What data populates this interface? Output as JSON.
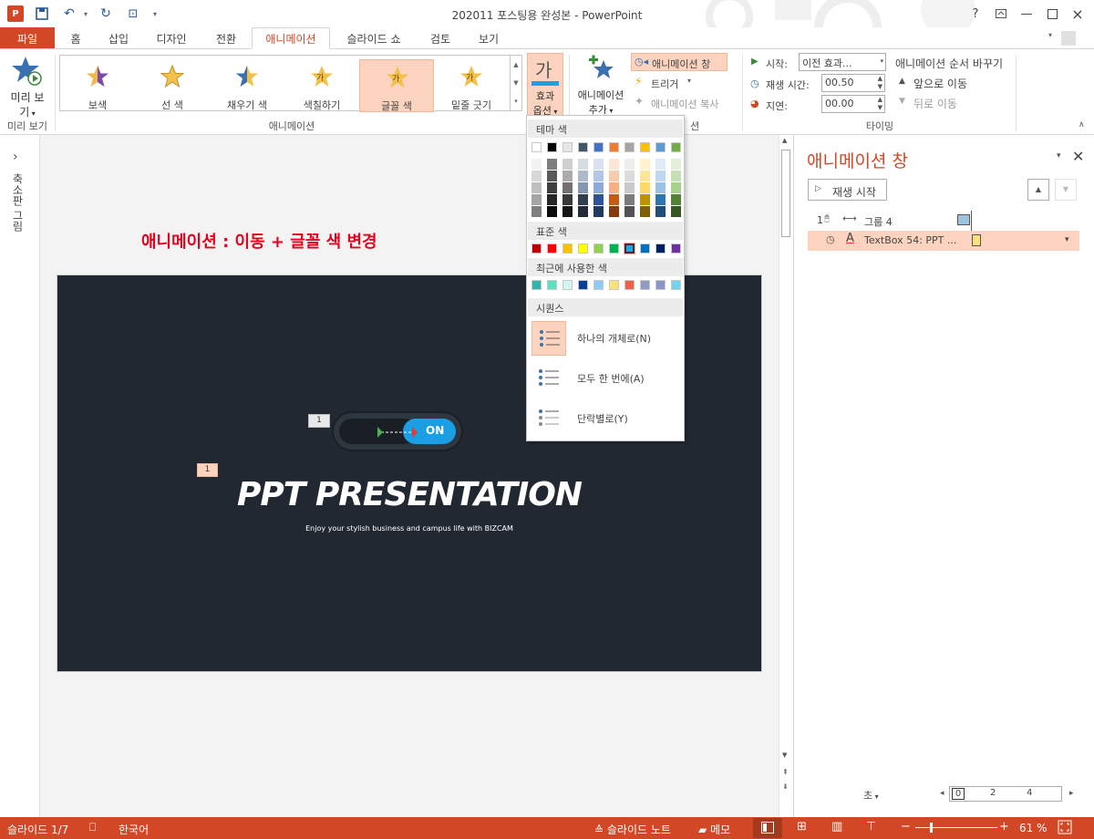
{
  "window": {
    "title": "202011 포스팅용 완성본 - PowerPoint",
    "help": "?",
    "close": "×"
  },
  "ribbon_tabs": {
    "file": "파일",
    "items": [
      "홈",
      "삽입",
      "디자인",
      "전환",
      "애니메이션",
      "슬라이드 쇼",
      "검토",
      "보기"
    ],
    "active": "애니메이션"
  },
  "preview": {
    "label_line1": "미리 보",
    "label_line2": "기",
    "group": "미리 보기"
  },
  "animations_gallery": {
    "items": [
      {
        "label": "보색",
        "icon": "star-two-tone-icon"
      },
      {
        "label": "선 색",
        "icon": "star-gold-icon"
      },
      {
        "label": "채우기 색",
        "icon": "star-blue-gold-icon"
      },
      {
        "label": "색칠하기",
        "icon": "star-text-icon",
        "glyph": "가"
      },
      {
        "label": "글꼴 색",
        "icon": "star-text-icon",
        "glyph": "가"
      },
      {
        "label": "밑줄 긋기",
        "icon": "star-text-icon",
        "glyph": "가"
      }
    ],
    "selected_index": 4,
    "group": "애니메이션"
  },
  "effect_options": {
    "glyph": "가",
    "line1": "효과",
    "line2": "옵션",
    "accent": "#1ba1e2"
  },
  "add_animation": {
    "line1": "애니메이션",
    "line2": "추가"
  },
  "advanced": {
    "pane_btn": "애니메이션 창",
    "trigger": "트리거",
    "painter": "애니메이션 복사",
    "group_suffix": "션"
  },
  "timing": {
    "start_label": "시작:",
    "start_value": "이전 효과...",
    "duration_label": "재생 시간:",
    "duration_value": "00.50",
    "delay_label": "지연:",
    "delay_value": "00.00",
    "reorder_title": "애니메이션 순서 바꾸기",
    "move_earlier": "앞으로 이동",
    "move_later": "뒤로 이동",
    "group": "타이밍"
  },
  "dropdown": {
    "theme_header": "테마 색",
    "standard_header": "표준 색",
    "recent_header": "최근에 사용한 색",
    "sequence_header": "시퀀스",
    "theme_top": [
      "#ffffff",
      "#000000",
      "#e7e6e6",
      "#44546a",
      "#4472c4",
      "#ed7d31",
      "#a5a5a5",
      "#ffc000",
      "#5b9bd5",
      "#70ad47"
    ],
    "theme_shades": [
      [
        "#f2f2f2",
        "#7f7f7f",
        "#d0cece",
        "#d6dce4",
        "#d9e2f3",
        "#fbe5d5",
        "#ededed",
        "#fff2cc",
        "#deebf6",
        "#e2efd9"
      ],
      [
        "#d8d8d8",
        "#595959",
        "#aeabab",
        "#adb9ca",
        "#b4c6e7",
        "#f7cbac",
        "#dbdbdb",
        "#fee599",
        "#bdd7ee",
        "#c5e0b3"
      ],
      [
        "#bfbfbf",
        "#3f3f3f",
        "#757070",
        "#8496b0",
        "#8eaadb",
        "#f4b183",
        "#c9c9c9",
        "#ffd966",
        "#9cc3e5",
        "#a8d08d"
      ],
      [
        "#a5a5a5",
        "#262626",
        "#3a3838",
        "#323f4f",
        "#2f5496",
        "#c55a11",
        "#7b7b7b",
        "#bf9000",
        "#2e75b5",
        "#538135"
      ],
      [
        "#7f7f7f",
        "#0c0c0c",
        "#171616",
        "#222a35",
        "#1f3864",
        "#833c0b",
        "#525252",
        "#7f6000",
        "#1e4e79",
        "#375623"
      ]
    ],
    "standard": [
      "#c00000",
      "#ff0000",
      "#ffc000",
      "#ffff00",
      "#92d050",
      "#00b050",
      "#00b0f0",
      "#0070c0",
      "#002060",
      "#7030a0"
    ],
    "standard_selected_index": 6,
    "recent": [
      "#33b3ab",
      "#5ce1c0",
      "#d5f6ef",
      "#0a3e99",
      "#8fcbf2",
      "#ffe17a",
      "#f05f4a",
      "#8f9cc8",
      "#8a96c8",
      "#72d3ef"
    ],
    "sequence": [
      {
        "label": "하나의 개체로(N)",
        "icon": "as-one-object-icon"
      },
      {
        "label": "모두 한 번에(A)",
        "icon": "all-at-once-icon"
      },
      {
        "label": "단락별로(Y)",
        "icon": "by-paragraph-icon"
      }
    ]
  },
  "leftbar": {
    "expand": "›",
    "label": "축소판 그림"
  },
  "slide": {
    "heading": "애니메이션 : 이동 + 글꼴 색 변경",
    "heading_color": "#e8001c",
    "tag_1": "1",
    "tag_2": "1",
    "toggle_text": "ON",
    "title": "PPT PRESENTATION",
    "subtitle": "Enjoy your stylish business and campus life with BIZCAM"
  },
  "anim_pane": {
    "title": "애니메이션 창",
    "play_btn": "재생 시작",
    "items": [
      {
        "num": "1",
        "name": "그룹 4",
        "color": "#9ec3de"
      },
      {
        "num": "",
        "name": "TextBox 54: PPT ...",
        "color": "#fde07c"
      }
    ],
    "seconds": "초",
    "timeline_ticks": [
      "0",
      "2",
      "4"
    ]
  },
  "status": {
    "slide": "슬라이드 1/7",
    "lang": "한국어",
    "notes": "슬라이드 노트",
    "comments": "메모",
    "zoom": "61 %"
  }
}
